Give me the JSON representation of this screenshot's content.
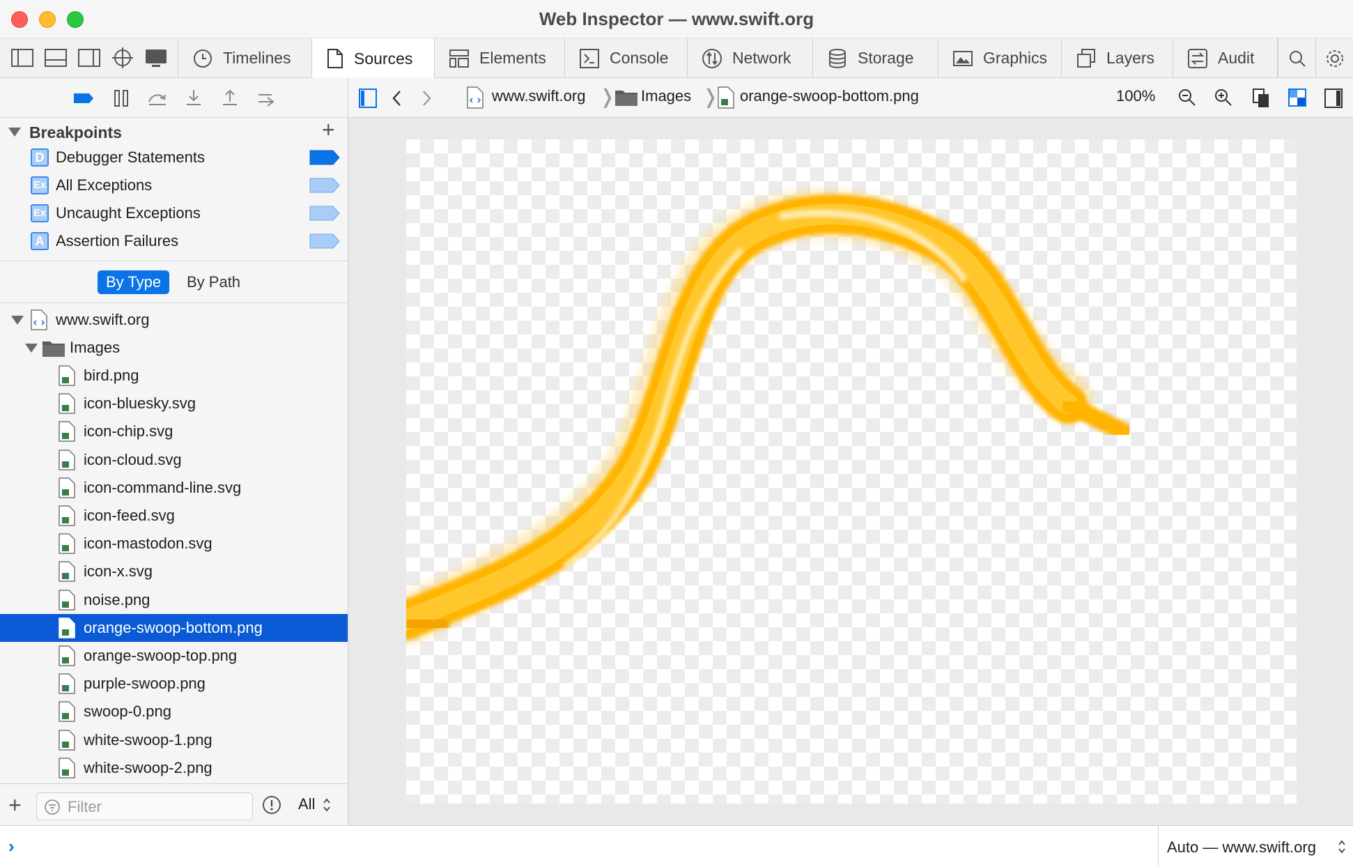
{
  "window": {
    "title": "Web Inspector — www.swift.org"
  },
  "tabs": [
    {
      "label": "Timelines",
      "icon": "clock-icon"
    },
    {
      "label": "Sources",
      "icon": "document-icon",
      "active": true
    },
    {
      "label": "Elements",
      "icon": "elements-icon"
    },
    {
      "label": "Console",
      "icon": "console-icon"
    },
    {
      "label": "Network",
      "icon": "network-icon"
    },
    {
      "label": "Storage",
      "icon": "database-icon"
    },
    {
      "label": "Graphics",
      "icon": "image-icon"
    },
    {
      "label": "Layers",
      "icon": "layers-icon"
    },
    {
      "label": "Audit",
      "icon": "audit-icon"
    }
  ],
  "breakpoints": {
    "title": "Breakpoints",
    "items": [
      {
        "badge": "D",
        "label": "Debugger Statements",
        "enabled": true
      },
      {
        "badge": "Ex",
        "label": "All Exceptions",
        "enabled": false
      },
      {
        "badge": "Ex",
        "label": "Uncaught Exceptions",
        "enabled": false
      },
      {
        "badge": "A",
        "label": "Assertion Failures",
        "enabled": false
      }
    ]
  },
  "grouping": {
    "by_type": "By Type",
    "by_path": "By Path",
    "selected": "By Type"
  },
  "tree": {
    "root": "www.swift.org",
    "folder": "Images",
    "files": [
      "bird.png",
      "icon-bluesky.svg",
      "icon-chip.svg",
      "icon-cloud.svg",
      "icon-command-line.svg",
      "icon-feed.svg",
      "icon-mastodon.svg",
      "icon-x.svg",
      "noise.png",
      "orange-swoop-bottom.png",
      "orange-swoop-top.png",
      "purple-swoop.png",
      "swoop-0.png",
      "white-swoop-1.png",
      "white-swoop-2.png"
    ],
    "selected": "orange-swoop-bottom.png"
  },
  "filter": {
    "placeholder": "Filter",
    "scope": "All"
  },
  "navbar": {
    "crumbs": [
      "www.swift.org",
      "Images",
      "orange-swoop-bottom.png"
    ],
    "zoom": "100%"
  },
  "console": {
    "prompt": "›",
    "context": "Auto — www.swift.org"
  },
  "colors": {
    "accent": "#0a74e6",
    "selection": "#0a5ad6",
    "swoop": "#ffb400"
  }
}
